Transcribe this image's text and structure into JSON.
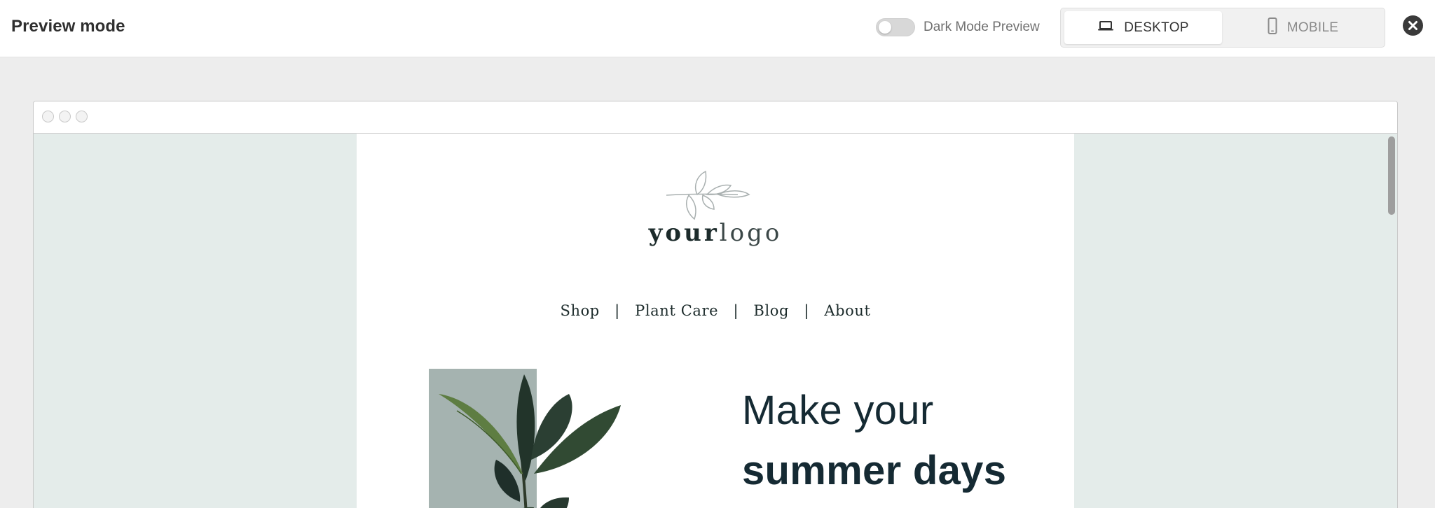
{
  "header": {
    "title": "Preview mode",
    "dark_mode_label": "Dark Mode Preview",
    "dark_mode_on": false,
    "devices": [
      {
        "label": "DESKTOP",
        "icon": "laptop-icon",
        "active": true
      },
      {
        "label": "MOBILE",
        "icon": "mobile-icon",
        "active": false
      }
    ],
    "close_icon": "close-icon"
  },
  "email": {
    "logo": {
      "bold": "your",
      "light": "logo",
      "icon": "leaf-branch-icon"
    },
    "nav": [
      {
        "label": "Shop"
      },
      {
        "label": "Plant Care"
      },
      {
        "label": "Blog"
      },
      {
        "label": "About"
      }
    ],
    "nav_separator": "|",
    "hero": {
      "line1": "Make your",
      "line2": "summer days"
    }
  },
  "colors": {
    "canvas_bg": "#e4ecea",
    "heading": "#152a33",
    "plant_bg": "#a5b3b0"
  }
}
